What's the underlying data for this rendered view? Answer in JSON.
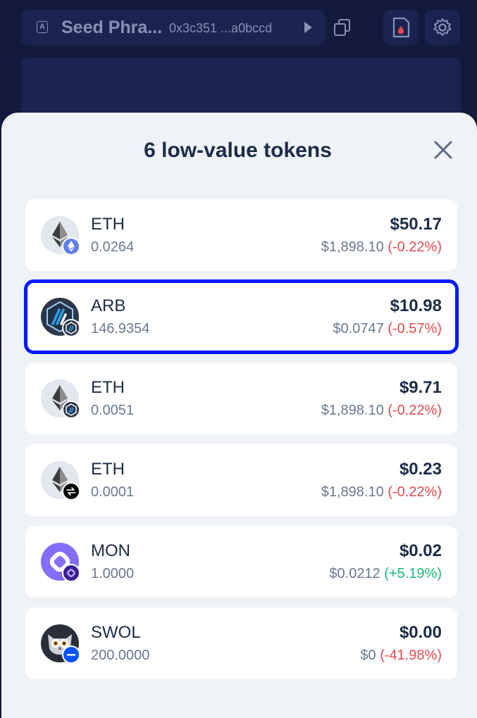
{
  "header": {
    "account_name": "Seed Phra...",
    "account_address": "0x3c351 ...a0bccd"
  },
  "sheet": {
    "title": "6 low-value tokens"
  },
  "tokens": [
    {
      "symbol": "ETH",
      "amount": "0.0264",
      "value": "$50.17",
      "price": "$1,898.10",
      "change": "(-0.22%)",
      "badge": "ethereum-network-icon",
      "highlighted": false
    },
    {
      "symbol": "ARB",
      "amount": "146.9354",
      "value": "$10.98",
      "price": "$0.0747",
      "change": "(-0.57%)",
      "badge": "arbitrum-network-icon",
      "highlighted": true
    },
    {
      "symbol": "ETH",
      "amount": "0.0051",
      "value": "$9.71",
      "price": "$1,898.10",
      "change": "(-0.22%)",
      "badge": "arbitrum-network-icon",
      "highlighted": false
    },
    {
      "symbol": "ETH",
      "amount": "0.0001",
      "value": "$0.23",
      "price": "$1,898.10",
      "change": "(-0.22%)",
      "badge": "swap-network-icon",
      "highlighted": false
    },
    {
      "symbol": "MON",
      "amount": "1.0000",
      "value": "$0.02",
      "price": "$0.0212",
      "change": "(+5.19%)",
      "badge": "monad-network-icon",
      "highlighted": false
    },
    {
      "symbol": "SWOL",
      "amount": "200.0000",
      "value": "$0.00",
      "price": "$0",
      "change": "(-41.98%)",
      "badge": "base-network-icon",
      "highlighted": false
    }
  ],
  "colors": {
    "negative": "#e5484d",
    "positive": "#18b978",
    "highlight": "#0019ff"
  }
}
